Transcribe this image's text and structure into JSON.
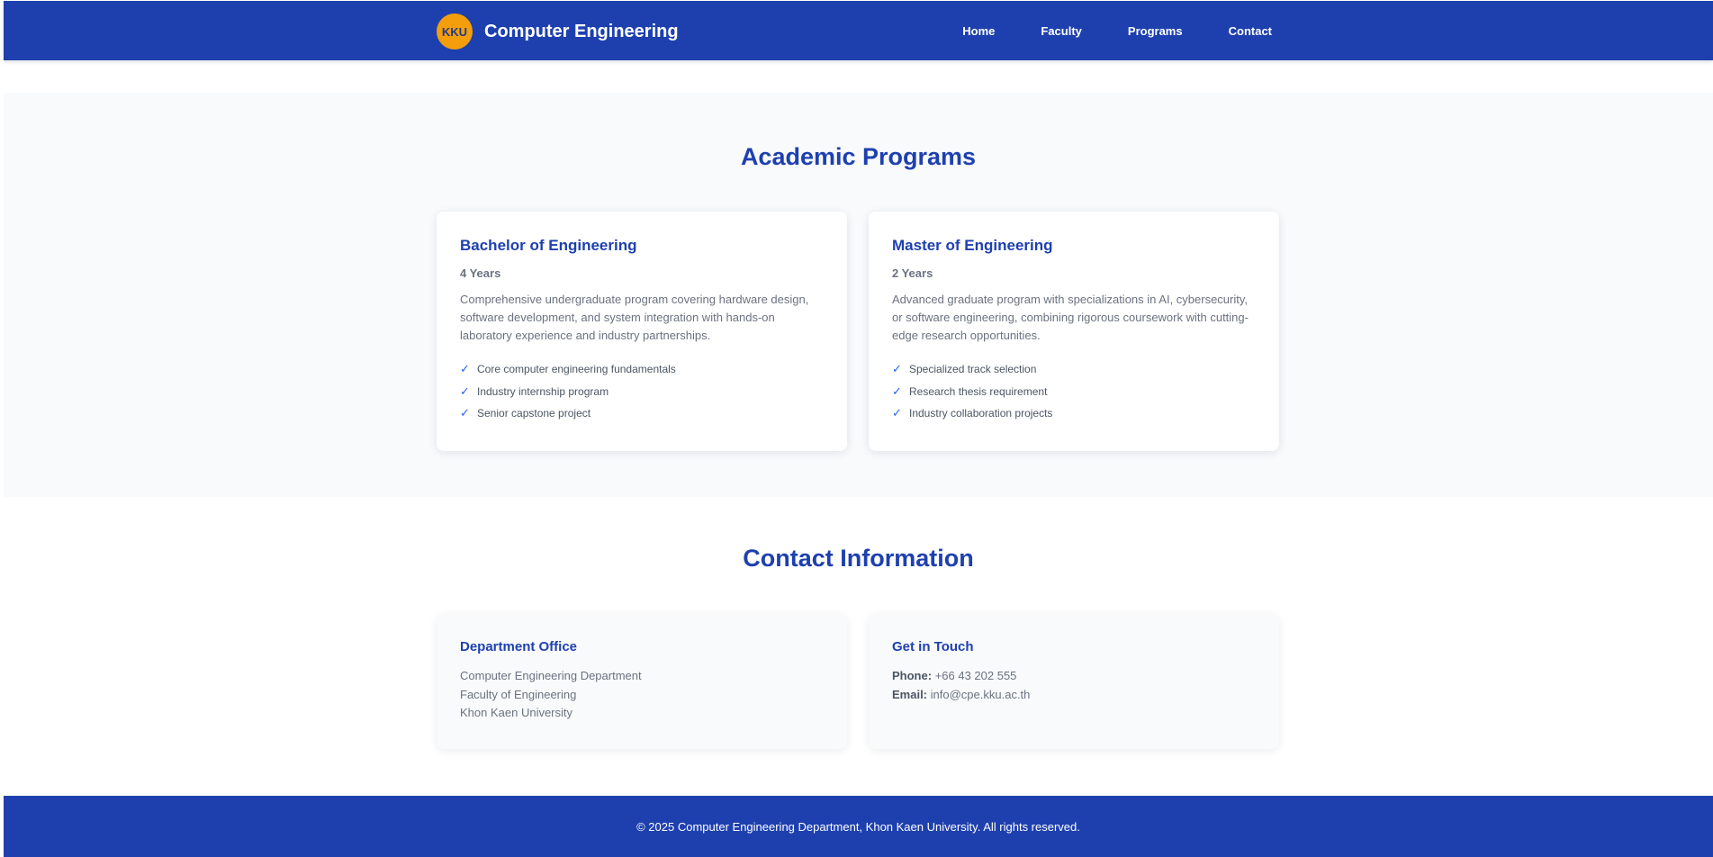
{
  "header": {
    "logo_text": "KKU",
    "title": "Computer Engineering",
    "nav": [
      "Home",
      "Faculty",
      "Programs",
      "Contact"
    ]
  },
  "programs": {
    "title": "Academic Programs",
    "cards": [
      {
        "title": "Bachelor of Engineering",
        "duration": "4 Years",
        "description": "Comprehensive undergraduate program covering hardware design, software development, and system integration with hands-on laboratory experience and industry partnerships.",
        "features": [
          "Core computer engineering fundamentals",
          "Industry internship program",
          "Senior capstone project"
        ]
      },
      {
        "title": "Master of Engineering",
        "duration": "2 Years",
        "description": "Advanced graduate program with specializations in AI, cybersecurity, or software engineering, combining rigorous coursework with cutting-edge research opportunities.",
        "features": [
          "Specialized track selection",
          "Research thesis requirement",
          "Industry collaboration projects"
        ]
      }
    ],
    "check_glyph": "✓"
  },
  "contact": {
    "title": "Contact Information",
    "office": {
      "title": "Department Office",
      "lines": [
        "Computer Engineering Department",
        "Faculty of Engineering",
        "Khon Kaen University"
      ]
    },
    "touch": {
      "title": "Get in Touch",
      "phone_label": "Phone:",
      "phone": "+66 43 202 555",
      "email_label": "Email:",
      "email": "info@cpe.kku.ac.th"
    }
  },
  "footer": {
    "text": "© 2025 Computer Engineering Department, Khon Kaen University. All rights reserved."
  },
  "colors": {
    "primary": "#1e40af",
    "accent": "#f59e0b",
    "section_bg": "#f8fafc"
  }
}
